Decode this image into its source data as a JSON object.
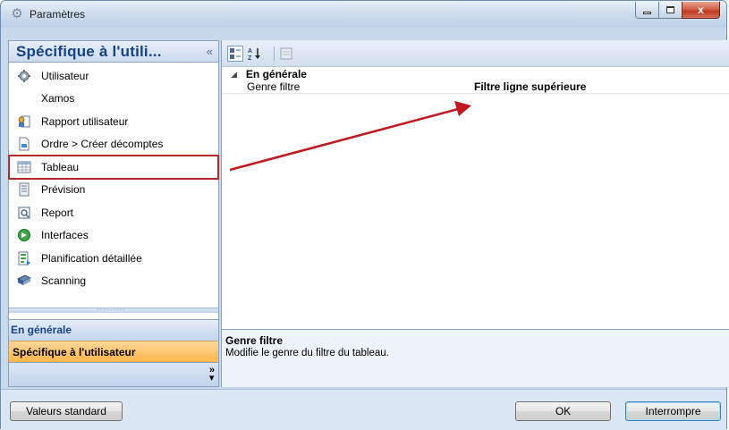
{
  "window": {
    "title": "Paramètres",
    "minimize_label": "",
    "maximize_label": "",
    "close_label": "x"
  },
  "left_panel": {
    "header_title": "Spécifique  à  l'utili...",
    "collapse_glyph": "«",
    "items": [
      {
        "label": "Utilisateur",
        "icon": "gear-icon"
      },
      {
        "label": "Xamos",
        "icon": ""
      },
      {
        "label": "Rapport utilisateur",
        "icon": "user-report-icon"
      },
      {
        "label": "Ordre > Créer décomptes",
        "icon": "document-icon"
      },
      {
        "label": "Tableau",
        "icon": "table-icon"
      },
      {
        "label": "Prévision",
        "icon": "forecast-icon"
      },
      {
        "label": "Report",
        "icon": "report-icon"
      },
      {
        "label": "Interfaces",
        "icon": "interfaces-icon"
      },
      {
        "label": "Planification détaillée",
        "icon": "planning-icon"
      },
      {
        "label": "Scanning",
        "icon": "scanning-icon"
      }
    ],
    "nav": {
      "general": "En générale",
      "user_specific": "Spécifique à l'utilisateur",
      "more_glyph": "»"
    }
  },
  "property_grid": {
    "category": "En générale",
    "rows": [
      {
        "name": "Genre filtre",
        "value": "Filtre ligne supérieure"
      }
    ],
    "description": {
      "title": "Genre filtre",
      "text": "Modifie le genre du filtre du tableau."
    }
  },
  "footer": {
    "standard_button": "Valeurs standard",
    "ok_button": "OK",
    "cancel_button": "Interrompre"
  },
  "colors": {
    "annotation": "#c0181e",
    "nav_active": "#ffb54a",
    "header_text": "#15428b"
  }
}
